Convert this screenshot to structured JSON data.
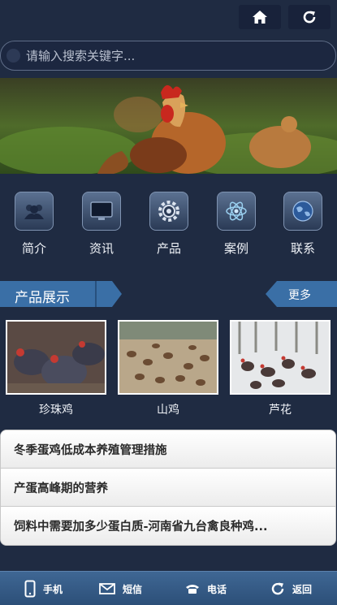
{
  "search": {
    "placeholder": "请输入搜索关键字..."
  },
  "nav": [
    {
      "label": "简介",
      "icon": "people-icon"
    },
    {
      "label": "资讯",
      "icon": "monitor-icon"
    },
    {
      "label": "产品",
      "icon": "gear-icon"
    },
    {
      "label": "案例",
      "icon": "atom-icon"
    },
    {
      "label": "联系",
      "icon": "globe-icon"
    }
  ],
  "section": {
    "title": "产品展示",
    "more": "更多"
  },
  "products": [
    {
      "name": "珍珠鸡"
    },
    {
      "name": "山鸡"
    },
    {
      "name": "芦花"
    }
  ],
  "news": [
    "冬季蛋鸡低成本养殖管理措施",
    "产蛋高峰期的营养",
    "饲料中需要加多少蛋白质-河南省九台禽良种鸡..."
  ],
  "footer": [
    {
      "label": "手机",
      "icon": "phone-icon"
    },
    {
      "label": "短信",
      "icon": "mail-icon"
    },
    {
      "label": "电话",
      "icon": "telephone-icon"
    },
    {
      "label": "返回",
      "icon": "back-icon"
    }
  ]
}
